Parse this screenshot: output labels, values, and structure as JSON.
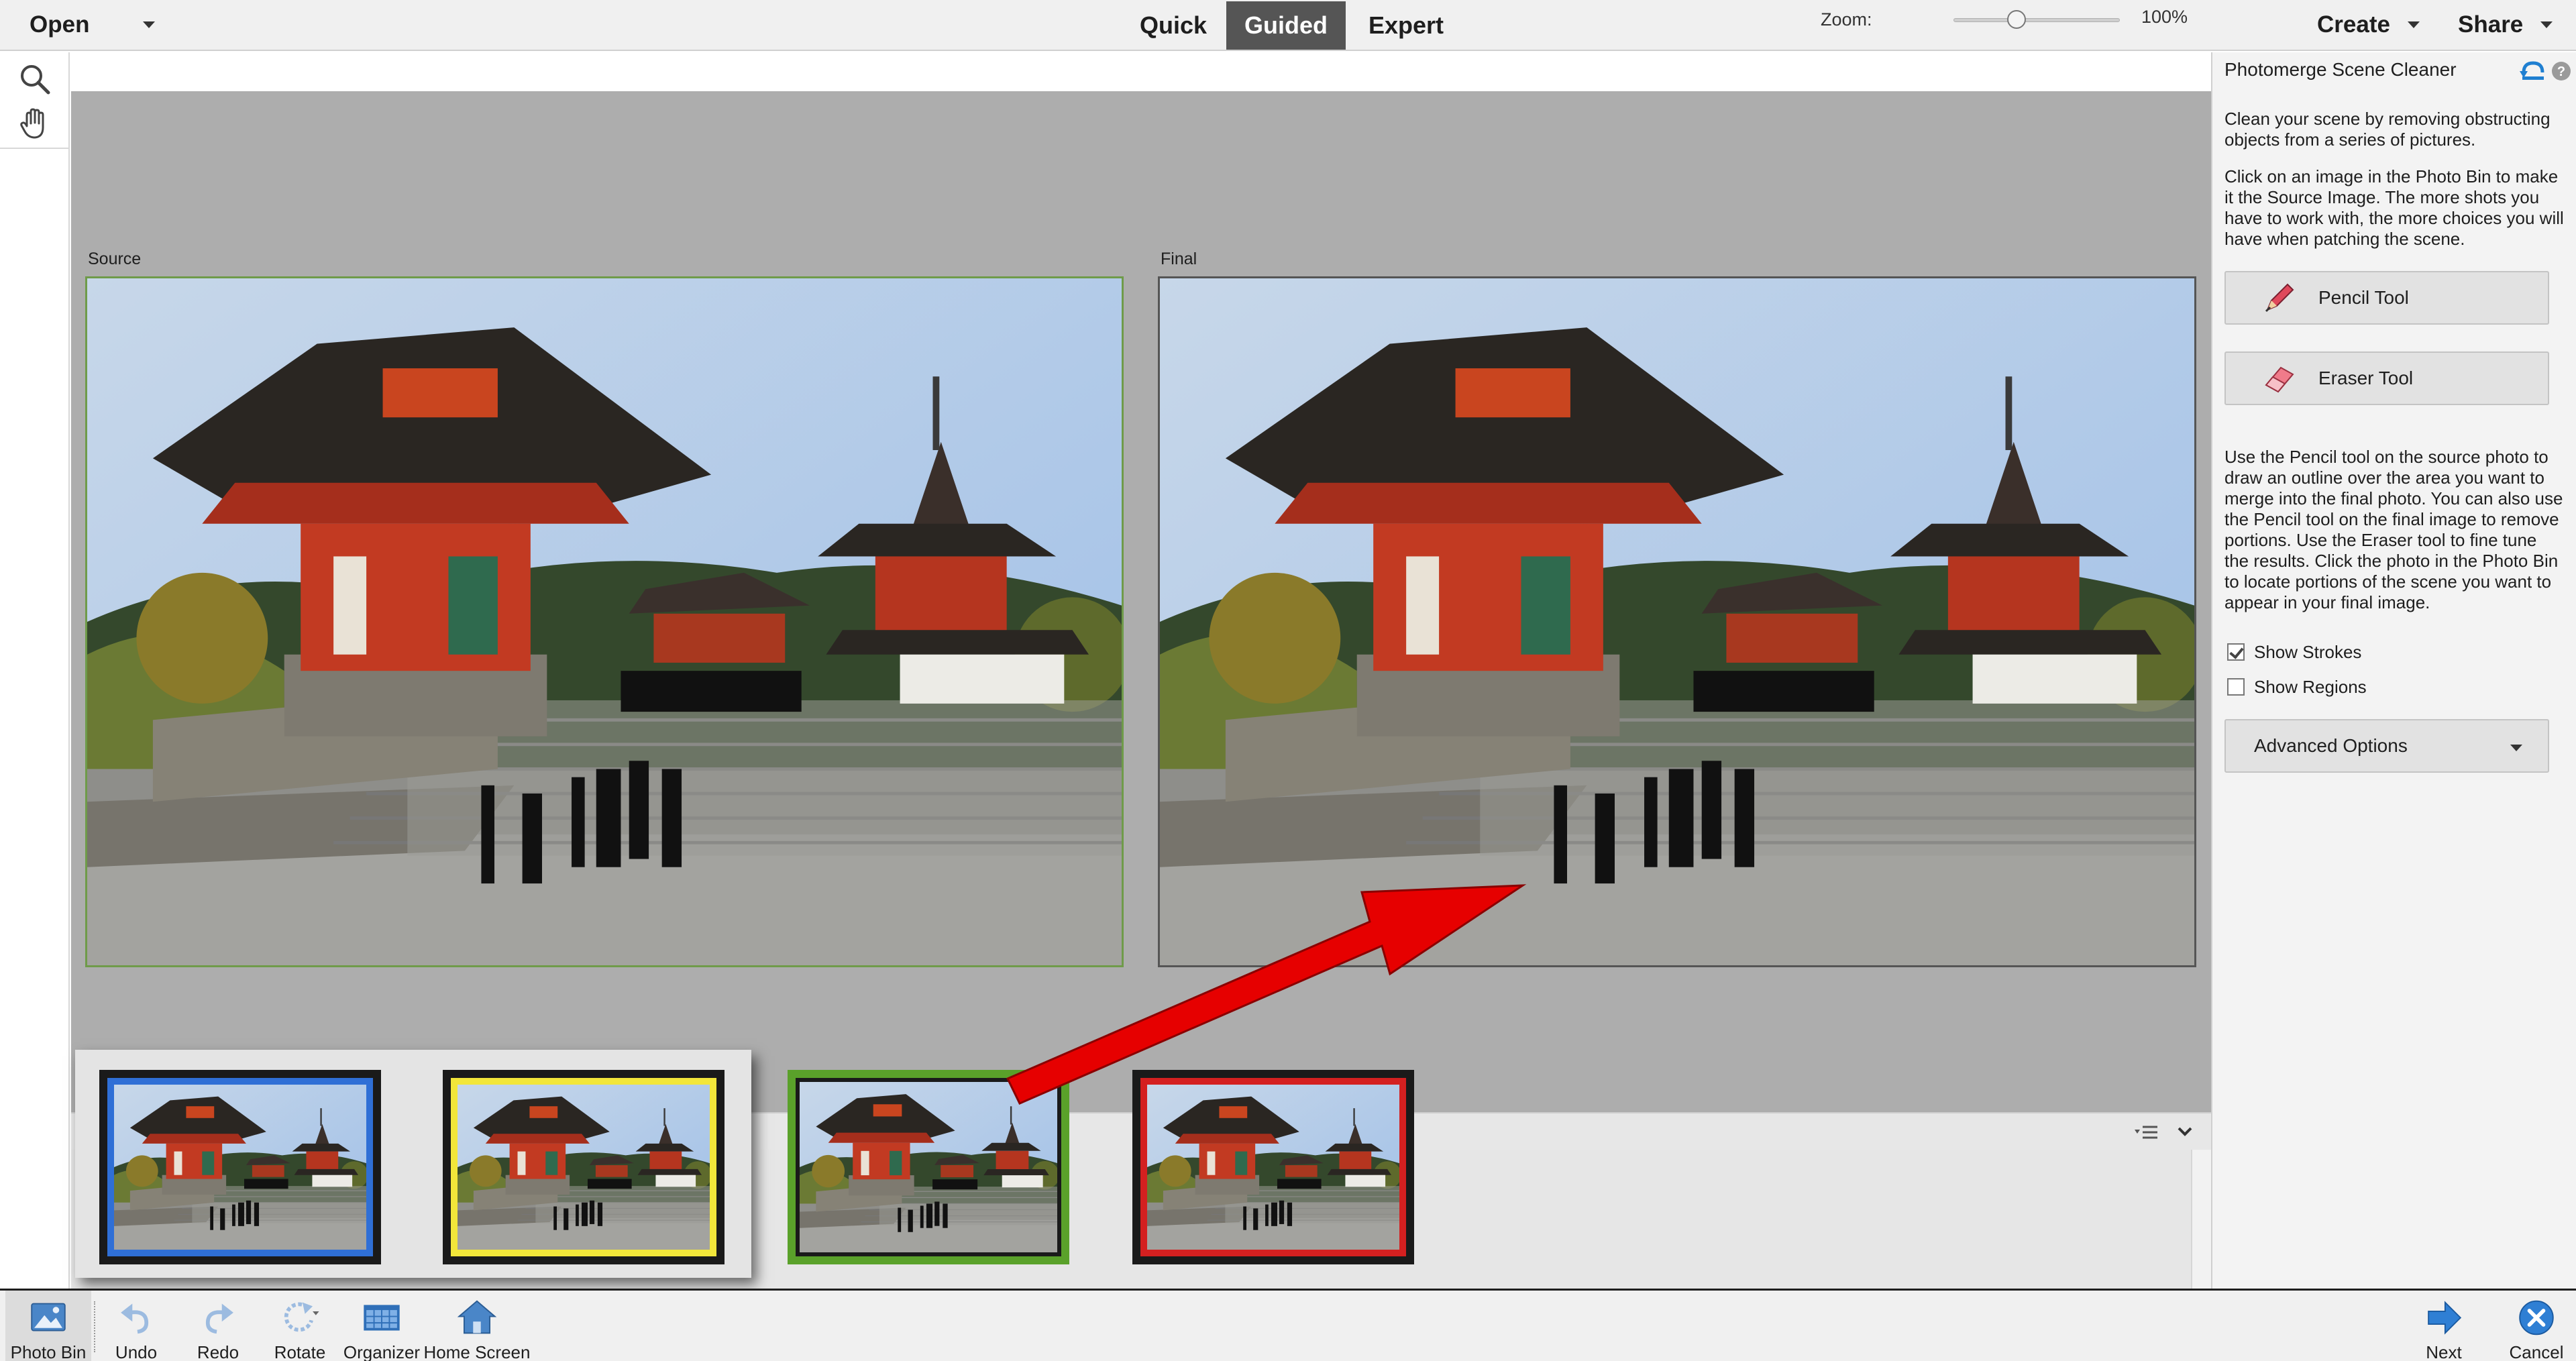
{
  "topbar": {
    "open_label": "Open",
    "modes": [
      {
        "label": "Quick",
        "active": false
      },
      {
        "label": "Guided",
        "active": true
      },
      {
        "label": "Expert",
        "active": false
      }
    ],
    "create_label": "Create",
    "share_label": "Share"
  },
  "tools": {
    "zoom_icon": "magnifier-icon",
    "hand_icon": "hand-icon"
  },
  "zoom": {
    "label": "Zoom:",
    "value": "100%",
    "level_fraction": 0.38
  },
  "canvas": {
    "source_label": "Source",
    "final_label": "Final"
  },
  "photo_bin": {
    "thumbnails": [
      {
        "border_color": "#2f6fd6"
      },
      {
        "border_color": "#f2e63a"
      },
      {
        "border_color": "#5aa12a"
      },
      {
        "border_color": "#d42020"
      }
    ]
  },
  "panel": {
    "title": "Photomerge Scene Cleaner",
    "intro": "Clean your scene by removing obstructing objects from a series of pictures.",
    "instructions_1": "Click on an image in the Photo Bin to make it the Source Image. The more shots you have to work with, the more choices you will have when patching the scene.",
    "pencil_label": "Pencil Tool",
    "eraser_label": "Eraser Tool",
    "instructions_2": "Use the Pencil tool on the source photo to draw an outline over the area you want to merge into the final photo. You can also use the Pencil tool on the final image to remove portions. Use the Eraser tool to fine tune the results. Click the photo in the Photo Bin to locate portions of the scene you want to appear in your final image.",
    "show_strokes_label": "Show Strokes",
    "show_strokes_checked": true,
    "show_regions_label": "Show Regions",
    "show_regions_checked": false,
    "advanced_label": "Advanced Options"
  },
  "bottombar": {
    "photo_bin": "Photo Bin",
    "undo": "Undo",
    "redo": "Redo",
    "rotate": "Rotate",
    "organizer": "Organizer",
    "home_screen": "Home Screen",
    "next": "Next",
    "cancel": "Cancel"
  },
  "colors": {
    "active_tab": "#555555",
    "accent_blue": "#1f7fd1",
    "arrow_red": "#e60000"
  }
}
